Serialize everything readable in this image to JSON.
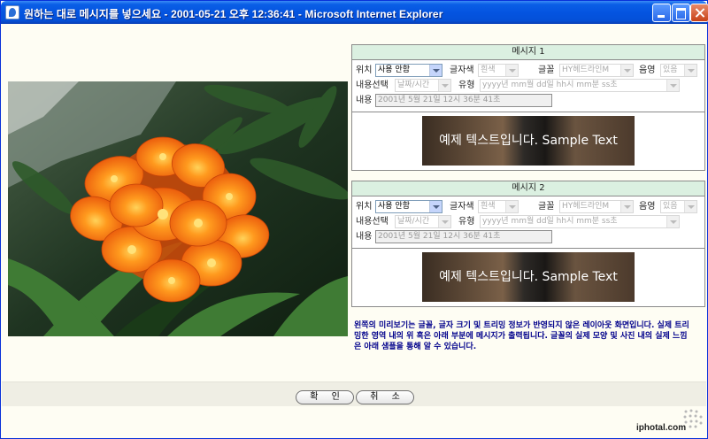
{
  "window": {
    "title": "원하는 대로 메시지를 넣으세요 - 2001-05-21 오후 12:36:41 - Microsoft Internet Explorer"
  },
  "labels": {
    "position": "위치",
    "font_color": "글자색",
    "font": "글꼴",
    "shadow": "음영",
    "content_select": "내용선택",
    "type": "유형",
    "content": "내용"
  },
  "panel1": {
    "title": "메시지 1",
    "position_value": "사용 안함",
    "font_color_value": "흰색",
    "font_value": "HY헤드라인M",
    "shadow_value": "있음",
    "content_select_value": "날짜/시간",
    "type_value": "yyyy년 mm월 dd일 hh시 mm분 ss초",
    "content_value": "2001년 5월 21일 12시 36분 41초",
    "sample_text": "예제 텍스트입니다. Sample Text"
  },
  "panel2": {
    "title": "메시지 2",
    "position_value": "사용 안함",
    "font_color_value": "흰색",
    "font_value": "HY헤드라인M",
    "shadow_value": "있음",
    "content_select_value": "날짜/시간",
    "type_value": "yyyy년 mm월 dd일 hh시 mm분 ss초",
    "content_value": "2001년 5월 21일 12시 36분 41초",
    "sample_text": "예제 텍스트입니다. Sample Text"
  },
  "info_text": "왼쪽의 미리보기는 글꼴, 글자 크기 및 트리밍 정보가 반영되지 않은 레이아웃 화면입니다. 실제 트리밍한 영역 내의 위 혹은 아래 부분에 메시지가 출력됩니다. 글꼴의 실제 모양 및 사진 내의 실제 느낌은 아래 샘플을 통해 알 수 있습니다.",
  "buttons": {
    "ok": "확 인",
    "cancel": "취 소"
  },
  "brand": "iphotal.com",
  "colors": {
    "panel_header": "#dbf0e1",
    "info_text": "#00008b",
    "titlebar": "#0454e0"
  }
}
